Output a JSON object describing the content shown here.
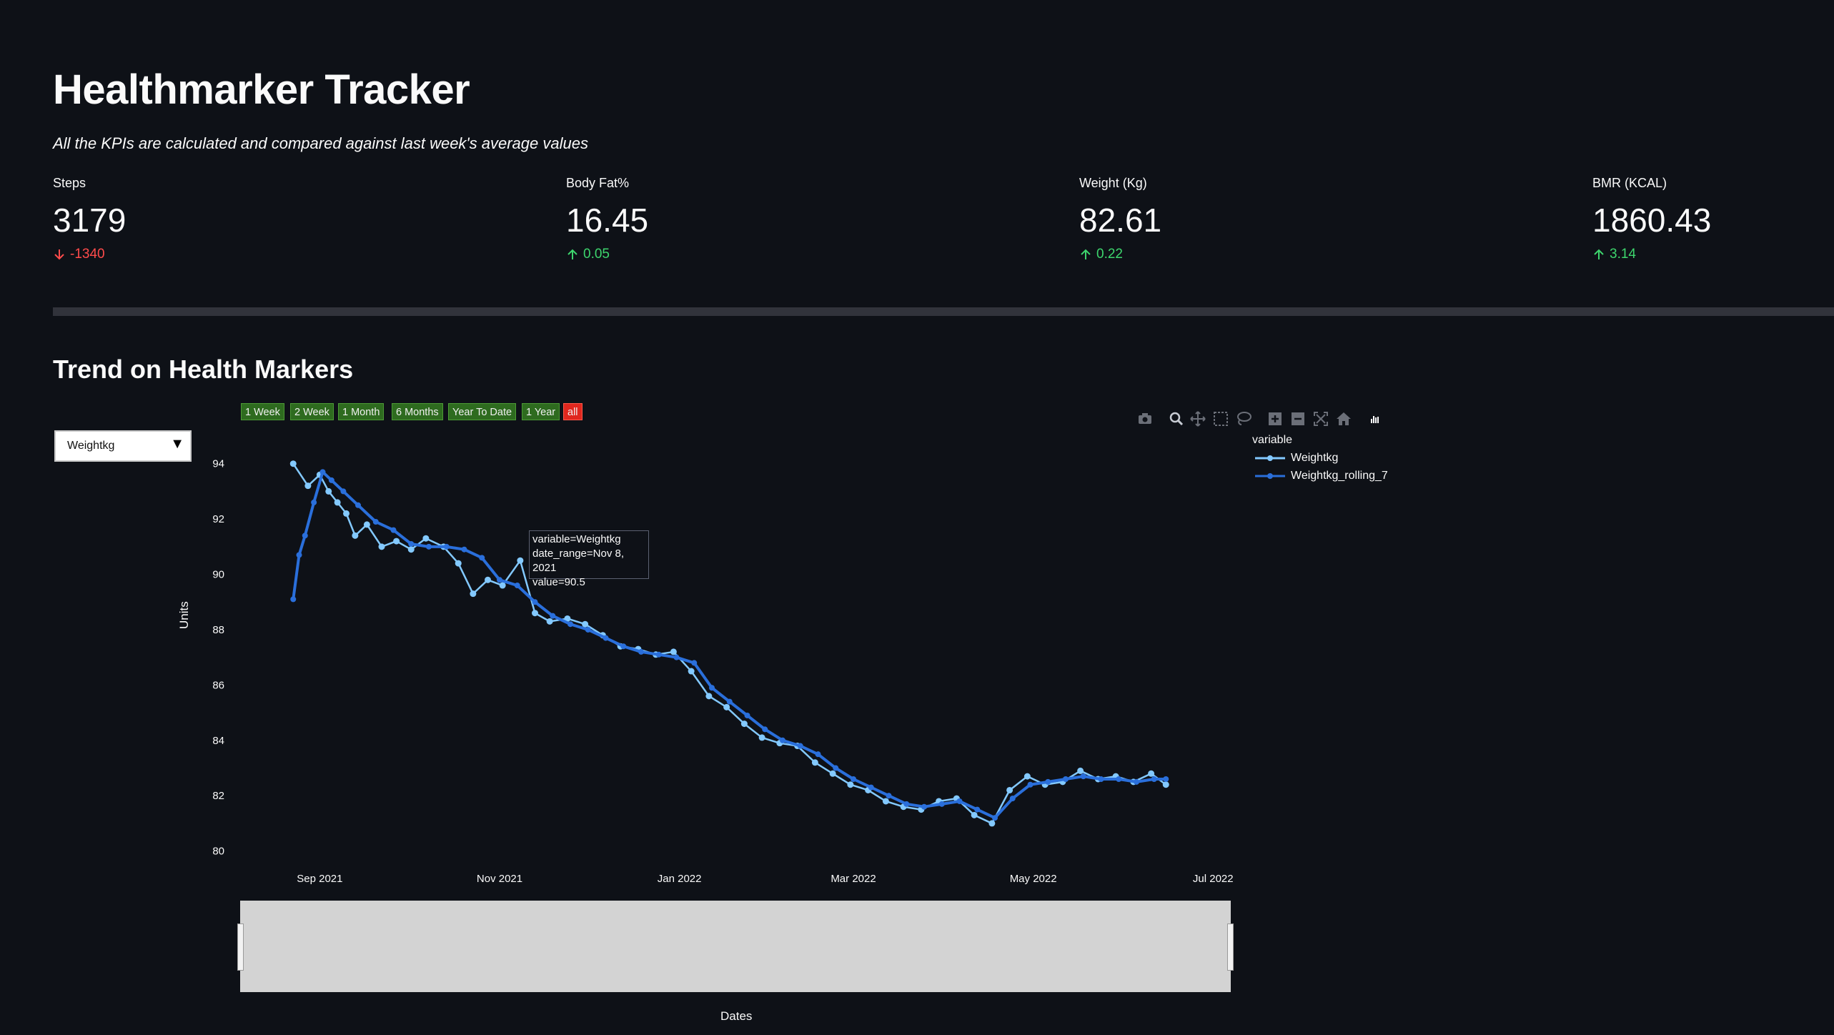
{
  "header": {
    "title": "Healthmarker Tracker",
    "subtitle": "All the KPIs are calculated and compared against last week's average values"
  },
  "kpis": [
    {
      "label": "Steps",
      "value": "3179",
      "delta": "-1340",
      "direction": "down"
    },
    {
      "label": "Body Fat%",
      "value": "16.45",
      "delta": "0.05",
      "direction": "up"
    },
    {
      "label": "Weight (Kg)",
      "value": "82.61",
      "delta": "0.22",
      "direction": "up"
    },
    {
      "label": "BMR (KCAL)",
      "value": "1860.43",
      "delta": "3.14",
      "direction": "up"
    }
  ],
  "section": {
    "title": "Trend on Health Markers"
  },
  "select": {
    "value": "Weightkg",
    "arrow": "▼"
  },
  "range_buttons": [
    "1 Week",
    "2 Week",
    "1 Month",
    "6 Months",
    "Year To Date",
    "1 Year",
    "all"
  ],
  "range_buttons_active": "all",
  "modebar_icons": [
    "camera-icon",
    "zoom-icon",
    "pan-icon",
    "box-select-icon",
    "lasso-icon",
    "zoom-in-icon",
    "zoom-out-icon",
    "autoscale-icon",
    "reset-axes-icon",
    "plotly-logo-icon"
  ],
  "colors": {
    "background": "#0e1117",
    "series_raw": "#83c9ff",
    "series_rolling": "#2a6fdb",
    "down": "#ff4b4b",
    "up": "#3dd56d"
  },
  "tooltip": {
    "line1": "variable=Weightkg",
    "line2": "date_range=Nov 8, 2021",
    "line3": "value=90.5"
  },
  "chart_data": {
    "type": "line",
    "title": "",
    "xlabel": "Dates",
    "ylabel": "Units",
    "ylim": [
      79.5,
      95
    ],
    "x_ticks": [
      "Sep 2021",
      "Nov 2021",
      "Jan 2022",
      "Mar 2022",
      "May 2022",
      "Jul 2022"
    ],
    "y_ticks": [
      80,
      82,
      84,
      86,
      88,
      90,
      92,
      94
    ],
    "legend_title": "variable",
    "legend_position": "top-right",
    "series": [
      {
        "name": "Weightkg",
        "x": [
          "2021-08-23",
          "2021-08-28",
          "2021-09-01",
          "2021-09-04",
          "2021-09-07",
          "2021-09-10",
          "2021-09-13",
          "2021-09-17",
          "2021-09-22",
          "2021-09-27",
          "2021-10-02",
          "2021-10-07",
          "2021-10-13",
          "2021-10-18",
          "2021-10-23",
          "2021-10-28",
          "2021-11-02",
          "2021-11-08",
          "2021-11-13",
          "2021-11-18",
          "2021-11-24",
          "2021-11-30",
          "2021-12-06",
          "2021-12-12",
          "2021-12-18",
          "2021-12-24",
          "2021-12-30",
          "2022-01-05",
          "2022-01-11",
          "2022-01-17",
          "2022-01-23",
          "2022-01-29",
          "2022-02-04",
          "2022-02-10",
          "2022-02-16",
          "2022-02-22",
          "2022-02-28",
          "2022-03-06",
          "2022-03-12",
          "2022-03-18",
          "2022-03-24",
          "2022-03-30",
          "2022-04-05",
          "2022-04-11",
          "2022-04-17",
          "2022-04-23",
          "2022-04-29",
          "2022-05-05",
          "2022-05-11",
          "2022-05-17",
          "2022-05-23",
          "2022-05-29",
          "2022-06-04",
          "2022-06-10",
          "2022-06-15"
        ],
        "y": [
          94.0,
          93.2,
          93.6,
          93.0,
          92.6,
          92.2,
          91.4,
          91.8,
          91.0,
          91.2,
          90.9,
          91.3,
          91.0,
          90.4,
          89.3,
          89.8,
          89.6,
          90.5,
          88.6,
          88.3,
          88.4,
          88.2,
          87.8,
          87.4,
          87.3,
          87.1,
          87.2,
          86.5,
          85.6,
          85.2,
          84.6,
          84.1,
          83.9,
          83.8,
          83.2,
          82.8,
          82.4,
          82.2,
          81.8,
          81.6,
          81.5,
          81.8,
          81.9,
          81.3,
          81.0,
          82.2,
          82.7,
          82.4,
          82.5,
          82.9,
          82.6,
          82.7,
          82.5,
          82.8,
          82.4
        ]
      },
      {
        "name": "Weightkg_rolling_7",
        "x": [
          "2021-08-23",
          "2021-08-25",
          "2021-08-27",
          "2021-08-30",
          "2021-09-02",
          "2021-09-05",
          "2021-09-09",
          "2021-09-14",
          "2021-09-20",
          "2021-09-26",
          "2021-10-02",
          "2021-10-08",
          "2021-10-14",
          "2021-10-20",
          "2021-10-26",
          "2021-11-01",
          "2021-11-07",
          "2021-11-13",
          "2021-11-19",
          "2021-11-25",
          "2021-12-01",
          "2021-12-07",
          "2021-12-13",
          "2021-12-19",
          "2021-12-25",
          "2021-12-31",
          "2022-01-06",
          "2022-01-12",
          "2022-01-18",
          "2022-01-24",
          "2022-01-30",
          "2022-02-05",
          "2022-02-11",
          "2022-02-17",
          "2022-02-23",
          "2022-03-01",
          "2022-03-07",
          "2022-03-13",
          "2022-03-19",
          "2022-03-25",
          "2022-03-31",
          "2022-04-06",
          "2022-04-12",
          "2022-04-18",
          "2022-04-24",
          "2022-04-30",
          "2022-05-06",
          "2022-05-12",
          "2022-05-18",
          "2022-05-24",
          "2022-05-30",
          "2022-06-05",
          "2022-06-11",
          "2022-06-15"
        ],
        "y": [
          89.1,
          90.7,
          91.4,
          92.6,
          93.7,
          93.4,
          93.0,
          92.5,
          91.9,
          91.6,
          91.1,
          91.0,
          91.0,
          90.9,
          90.6,
          89.8,
          89.6,
          89.0,
          88.5,
          88.2,
          88.0,
          87.7,
          87.4,
          87.2,
          87.1,
          87.0,
          86.8,
          85.9,
          85.4,
          84.9,
          84.4,
          84.0,
          83.8,
          83.5,
          83.0,
          82.6,
          82.3,
          82.0,
          81.7,
          81.6,
          81.7,
          81.8,
          81.5,
          81.2,
          81.9,
          82.4,
          82.5,
          82.6,
          82.7,
          82.6,
          82.6,
          82.5,
          82.6,
          82.6
        ]
      }
    ]
  }
}
